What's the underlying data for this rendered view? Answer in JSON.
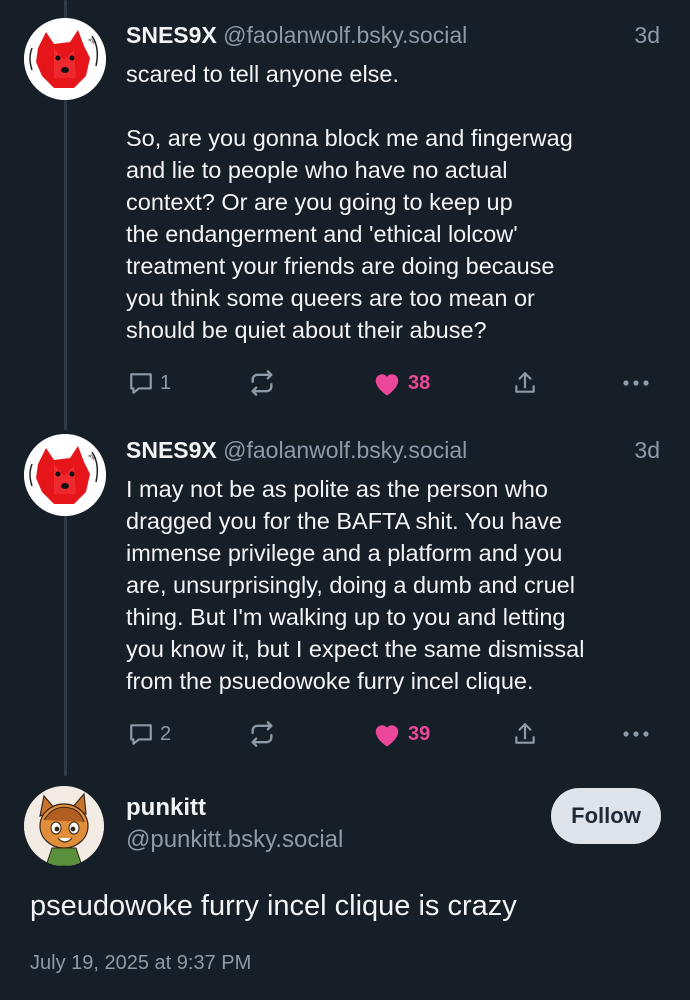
{
  "posts": [
    {
      "display_name": "SNES9X",
      "handle": "@faolanwolf.bsky.social",
      "time": "3d",
      "avatar_icon": "red-wolf-avatar-icon",
      "text": "scared to tell anyone else.\n\nSo, are you gonna block me and fingerwag\nand lie to people who have no actual\ncontext? Or are you going to keep up\nthe endangerment and 'ethical lolcow'\ntreatment your friends are doing because\nyou think some queers are too mean or\nshould be quiet about their abuse?",
      "reply_count": "1",
      "like_count": "38"
    },
    {
      "display_name": "SNES9X",
      "handle": "@faolanwolf.bsky.social",
      "time": "3d",
      "avatar_icon": "red-wolf-avatar-icon",
      "text": "I may not be as polite as the person who\ndragged you for the BAFTA shit. You have\nimmense privilege and a platform and you\nare, unsurprisingly, doing a dumb and cruel\nthing. But I'm walking up to you and letting\nyou know it, but I expect the same dismissal\nfrom the psuedowoke furry incel clique.",
      "reply_count": "2",
      "like_count": "39"
    }
  ],
  "main_post": {
    "display_name": "punkitt",
    "handle": "@punkitt.bsky.social",
    "follow_label": "Follow",
    "text": "pseudowoke furry incel clique is crazy",
    "date": "July 19, 2025 at 9:37 PM",
    "avatar_icon": "cartoon-cat-avatar-icon"
  },
  "colors": {
    "background": "#161e27",
    "text": "#f1f3f5",
    "muted": "#8d9aa8",
    "like": "#ec4899",
    "thread_line": "#2e3a48",
    "follow_bg": "#dfe4ea"
  }
}
